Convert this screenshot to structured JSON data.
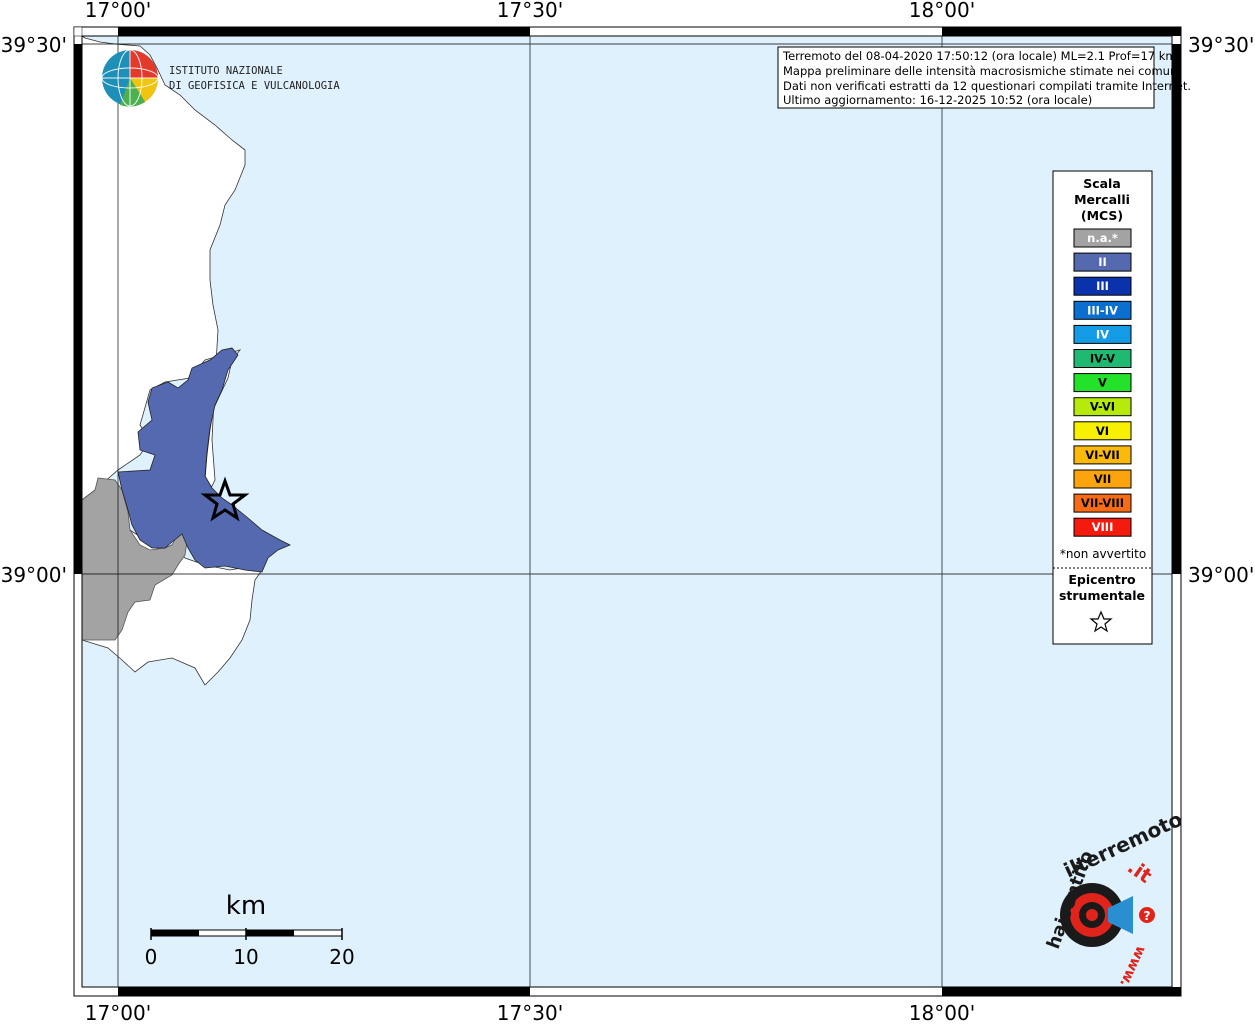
{
  "map": {
    "lon_labels": [
      "17°00'",
      "17°30'",
      "18°00'"
    ],
    "lat_labels": [
      "39°30'",
      "39°00'"
    ],
    "colors": {
      "sea": "#dff1fc",
      "land": "#ffffff",
      "intensity_ii": "#5469af",
      "not_available": "#a3a3a3",
      "grid": "#000000"
    }
  },
  "info_box": {
    "lines": [
      "Terremoto del 08-04-2020 17:50:12 (ora locale) ML=2.1 Prof=17 km",
      "Mappa preliminare delle intensità macrosismiche stimate nei comuni",
      "Dati non verificati estratti da 12 questionari compilati tramite Internet.",
      "Ultimo aggiornamento: 16-12-2025 10:52 (ora locale)"
    ]
  },
  "logo": {
    "line1": "ISTITUTO NAZIONALE",
    "line2": "DI GEOFISICA E VULCANOLOGIA"
  },
  "legend": {
    "title_lines": [
      "Scala",
      "Mercalli",
      "(MCS)"
    ],
    "items": [
      {
        "label": "n.a.*",
        "color": "#a3a3a3",
        "text_color": "#ffffff"
      },
      {
        "label": "II",
        "color": "#5469af",
        "text_color": "#ffffff"
      },
      {
        "label": "III",
        "color": "#0b32ad",
        "text_color": "#ffffff"
      },
      {
        "label": "III-IV",
        "color": "#0a6fce",
        "text_color": "#ffffff"
      },
      {
        "label": "IV",
        "color": "#139be6",
        "text_color": "#ffffff"
      },
      {
        "label": "IV-V",
        "color": "#1fb972",
        "text_color": "#000000"
      },
      {
        "label": "V",
        "color": "#24e22a",
        "text_color": "#000000"
      },
      {
        "label": "V-VI",
        "color": "#b6ea0c",
        "text_color": "#000000"
      },
      {
        "label": "VI",
        "color": "#f7f000",
        "text_color": "#000000"
      },
      {
        "label": "VI-VII",
        "color": "#fbb90a",
        "text_color": "#000000"
      },
      {
        "label": "VII",
        "color": "#fba40d",
        "text_color": "#000000"
      },
      {
        "label": "VII-VIII",
        "color": "#f86b15",
        "text_color": "#000000"
      },
      {
        "label": "VIII",
        "color": "#f41a0e",
        "text_color": "#ffffff"
      }
    ],
    "note": "*non avvertito",
    "epicenter_lines": [
      "Epicentro",
      "strumentale"
    ]
  },
  "scale_bar": {
    "unit": "km",
    "labels": [
      "0",
      "10",
      "20"
    ]
  },
  "brand": {
    "text1": "haisentito",
    "text2": "ilterremoto",
    "text3": ".it",
    "text4": "www.",
    "question": "?"
  }
}
